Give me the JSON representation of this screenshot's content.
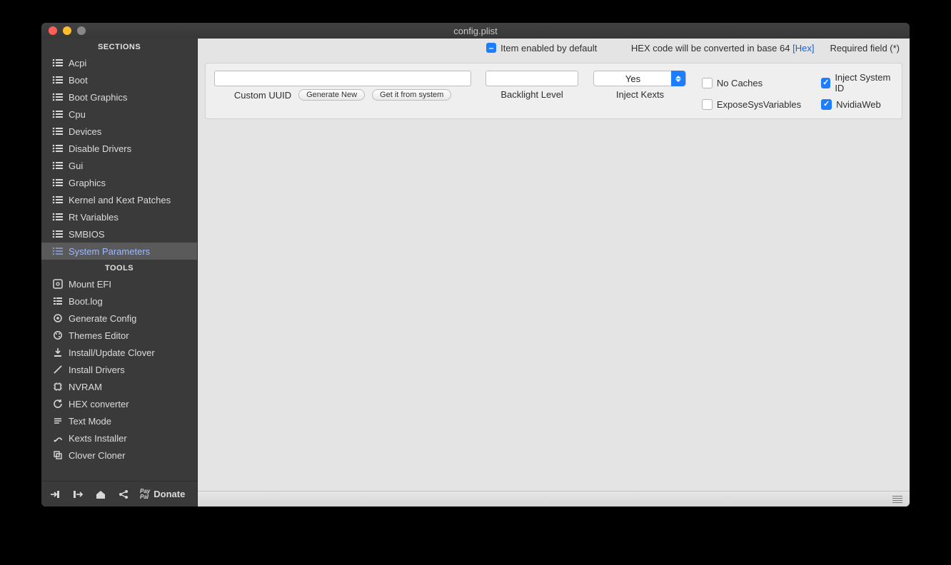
{
  "window": {
    "title": "config.plist"
  },
  "sidebar": {
    "sections_header": "SECTIONS",
    "tools_header": "TOOLS",
    "sections": [
      {
        "label": "Acpi"
      },
      {
        "label": "Boot"
      },
      {
        "label": "Boot Graphics"
      },
      {
        "label": "Cpu"
      },
      {
        "label": "Devices"
      },
      {
        "label": "Disable Drivers"
      },
      {
        "label": "Gui"
      },
      {
        "label": "Graphics"
      },
      {
        "label": "Kernel and Kext Patches"
      },
      {
        "label": "Rt Variables"
      },
      {
        "label": "SMBIOS"
      },
      {
        "label": "System Parameters"
      }
    ],
    "tools": [
      {
        "label": "Mount EFI"
      },
      {
        "label": "Boot.log"
      },
      {
        "label": "Generate Config"
      },
      {
        "label": "Themes Editor"
      },
      {
        "label": "Install/Update Clover"
      },
      {
        "label": "Install Drivers"
      },
      {
        "label": "NVRAM"
      },
      {
        "label": "HEX converter"
      },
      {
        "label": "Text Mode"
      },
      {
        "label": "Kexts Installer"
      },
      {
        "label": "Clover Cloner"
      }
    ]
  },
  "bottom": {
    "donate": "Donate"
  },
  "info": {
    "item_default": "Item enabled by default",
    "hex_note_prefix": "HEX code will be converted in base 64",
    "hex_link": "[Hex]",
    "required": "Required field (*)"
  },
  "panel": {
    "custom_uuid": {
      "value": "",
      "label": "Custom UUID",
      "btn_generate": "Generate New",
      "btn_get": "Get it from system"
    },
    "backlight": {
      "value": "",
      "label": "Backlight Level"
    },
    "inject_kexts": {
      "value": "Yes",
      "label": "Inject Kexts"
    },
    "checks": {
      "no_caches": {
        "label": "No Caches",
        "checked": false
      },
      "inject_system_id": {
        "label": "Inject System ID",
        "checked": true
      },
      "expose_sys_variables": {
        "label": "ExposeSysVariables",
        "checked": false
      },
      "nvidia_web": {
        "label": "NvidiaWeb",
        "checked": true
      }
    }
  }
}
